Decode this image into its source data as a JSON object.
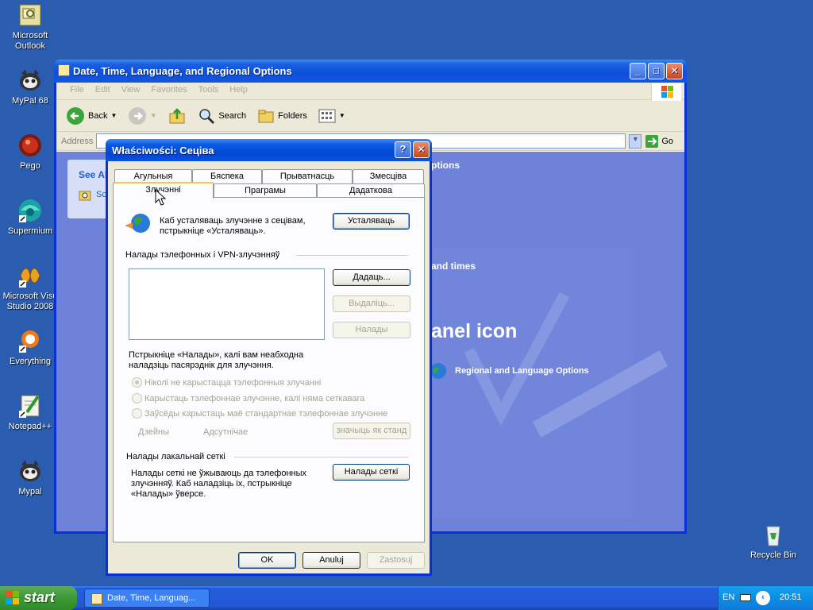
{
  "desktop": {
    "icons": [
      {
        "label": "Microsoft\nOutlook",
        "icon": "outlook-icon"
      },
      {
        "label": "MyPal 68",
        "icon": "mypal-icon"
      },
      {
        "label": "Pego",
        "icon": "pego-icon"
      },
      {
        "label": "Supermium",
        "icon": "supermium-icon"
      },
      {
        "label": "Microsoft Visu\nStudio 2008",
        "icon": "visual-studio-icon"
      },
      {
        "label": "Everything",
        "icon": "everything-icon"
      },
      {
        "label": "Notepad++",
        "icon": "notepadpp-icon"
      },
      {
        "label": "Mypal",
        "icon": "mypal-icon"
      },
      {
        "label": "Recycle Bin",
        "icon": "recycle-bin-icon"
      }
    ]
  },
  "explorer": {
    "title": "Date, Time, Language, and Regional Options",
    "menu": [
      "File",
      "Edit",
      "View",
      "Favorites",
      "Tools",
      "Help"
    ],
    "toolbar": {
      "back": "Back",
      "search": "Search",
      "folders": "Folders"
    },
    "address_label": "Address",
    "go_label": "Go",
    "see_also": "See Al",
    "sc": "Sc",
    "heading1": "ptions",
    "heading2": "and times",
    "heading3": "anel icon",
    "regional_link": "Regional and Language Options"
  },
  "dialog": {
    "title": "Właściwości: Сеціва",
    "tabs_row1": [
      "Агульныя",
      "Бяспека",
      "Прыватнасць",
      "Змесціва"
    ],
    "tabs_row2": [
      "Злучэнні",
      "Праграмы",
      "Дадатковa"
    ],
    "active_tab": "Злучэнні",
    "setup_text": "Каб усталяваць злучэнне з сецівам,\nпстрыкніце «Усталяваць».",
    "setup_button": "Усталяваць",
    "dialup_group": "Налады тэлефонных і VPN-злучэнняў",
    "add_button": "Дадаць...",
    "remove_button": "Выдаліць...",
    "settings_button": "Налады",
    "proxy_text": "Пстрыкніце «Налады», калі вам неабходна\nналадзіць пасярэднік для злучэння.",
    "radio_never": "Ніколі не карыстацца тэлефонныя злучанні",
    "radio_when_no_net": "Карыстаць тэлефоннае злучэнне, калі няма сеткавага",
    "radio_always": "Заўсёды карыстаць маё стандартнае тэлефоннае злучэнне",
    "current_label": "Дзейны",
    "none_label": "Адсутнічае",
    "set_default_button": "значыць як станд",
    "lan_group": "Налады лакальнай сеткі",
    "lan_text": "Налады сеткі не ўжываюць да тэлефонных\nзлучэнняў. Каб наладзіць іх, пстрыкніце\n«Налады» ўверсе.",
    "lan_button": "Налады сеткі",
    "ok_button": "OK",
    "cancel_button": "Anuluj",
    "apply_button": "Zastosuj"
  },
  "taskbar": {
    "start_label": "start",
    "task_label": "Date, Time, Languag...",
    "lang": "EN",
    "clock": "20:51"
  },
  "colors": {
    "desktop": "#2a5db0",
    "title_blue": "#0046d5",
    "dialog_face": "#ece9d8",
    "tab_highlight": "#ffc83c"
  }
}
